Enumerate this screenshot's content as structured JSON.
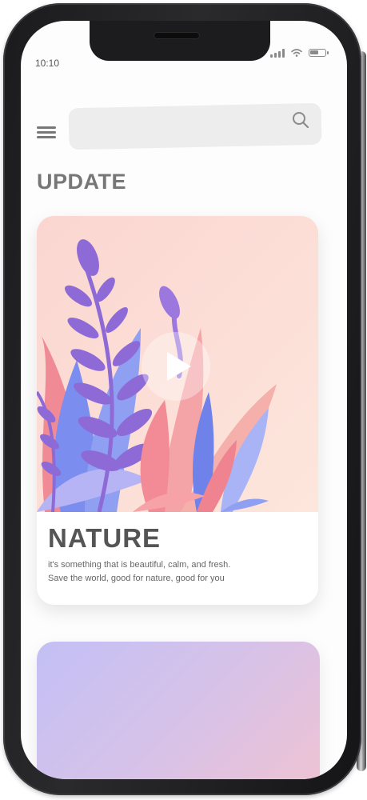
{
  "status_bar": {
    "time": "10:10",
    "battery_level": 0.6
  },
  "header": {
    "menu_icon": "hamburger-menu-icon",
    "search": {
      "placeholder": "",
      "icon": "search-icon"
    }
  },
  "section": {
    "title": "UPDATE"
  },
  "cards": [
    {
      "title": "NATURE",
      "description": [
        "it's something that is beautiful, calm, and fresh.",
        "Save the world, good for nature, good for you"
      ],
      "play_icon": "play-icon"
    }
  ],
  "colors": {
    "card_hero_bg": "#fbdcd4",
    "purple_leaf": "#8e6ad6",
    "blue_leaf": "#7b8ef0",
    "pink_leaf": "#f08a95",
    "next_card_gradient": [
      "#c3c0f5",
      "#f2c3d0"
    ]
  }
}
